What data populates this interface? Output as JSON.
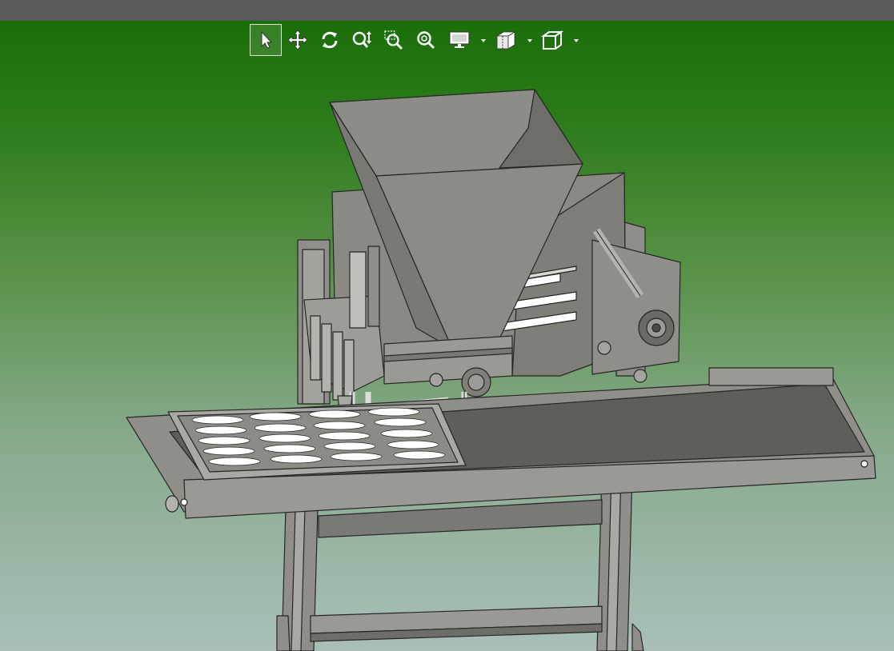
{
  "window": {
    "title": ""
  },
  "toolbar": {
    "tools": [
      {
        "id": "select",
        "icon": "arrow-pointer-icon",
        "selected": true
      },
      {
        "id": "pan",
        "icon": "move-arrows-icon",
        "selected": false
      },
      {
        "id": "rotate",
        "icon": "rotate-icon",
        "selected": false
      },
      {
        "id": "zoom",
        "icon": "zoom-updown-icon",
        "selected": false
      },
      {
        "id": "zoom-window",
        "icon": "zoom-window-icon",
        "selected": false
      },
      {
        "id": "zoom-fit",
        "icon": "zoom-fit-icon",
        "selected": false
      },
      {
        "id": "display-mode",
        "icon": "monitor-icon",
        "has_dropdown": true
      },
      {
        "id": "section",
        "icon": "section-view-icon",
        "has_dropdown": true
      },
      {
        "id": "view-orientation",
        "icon": "cube-view-icon",
        "has_dropdown": true
      }
    ]
  },
  "colors": {
    "background_top": "#1a6e08",
    "background_bottom": "#a9bfb8",
    "part_fill": "#8c8b86",
    "part_dark": "#6e6d69",
    "belt": "#5f5e5b",
    "edge": "#2a2a2a"
  },
  "model": {
    "description_icon": "depositor-machine-3d-model"
  }
}
